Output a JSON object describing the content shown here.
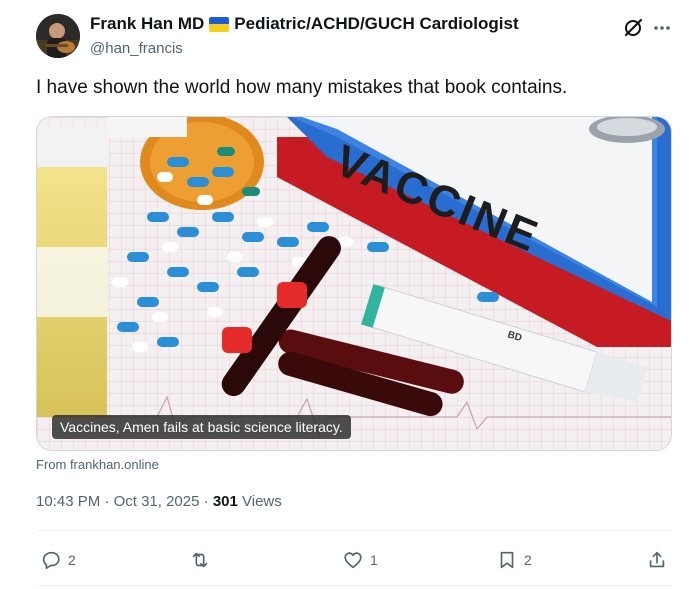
{
  "author": {
    "display_name": "Frank Han MD",
    "credential": "Pediatric/ACHD/GUCH Cardiologist",
    "handle": "@han_francis"
  },
  "icons": {
    "avatar": "avatar-image",
    "flag": "ukraine-flag-icon",
    "grok": "grok-icon",
    "more": "more-icon",
    "reply": "reply-icon",
    "retweet": "retweet-icon",
    "like": "heart-icon",
    "bookmark": "bookmark-icon",
    "share": "share-icon"
  },
  "tweet": {
    "text": "I have shown the world how many mistakes that book contains.",
    "media_caption": "Vaccines, Amen fails at basic science literacy.",
    "media_label": "VACCINE",
    "media_syringe_mark": "BD",
    "source": "From frankhan.online"
  },
  "meta": {
    "time": "10:43 PM",
    "date": "Oct 31, 2025",
    "separator": "·",
    "views_count": "301",
    "views_label": "Views"
  },
  "actions": {
    "replies": "2",
    "retweets": "",
    "likes": "1",
    "bookmarks": "2"
  },
  "colors": {
    "text_primary": "#0f1419",
    "text_secondary": "#536471",
    "border": "#cfd9de",
    "flag_blue": "#1e5bd6",
    "flag_yellow": "#f7cf1c"
  }
}
